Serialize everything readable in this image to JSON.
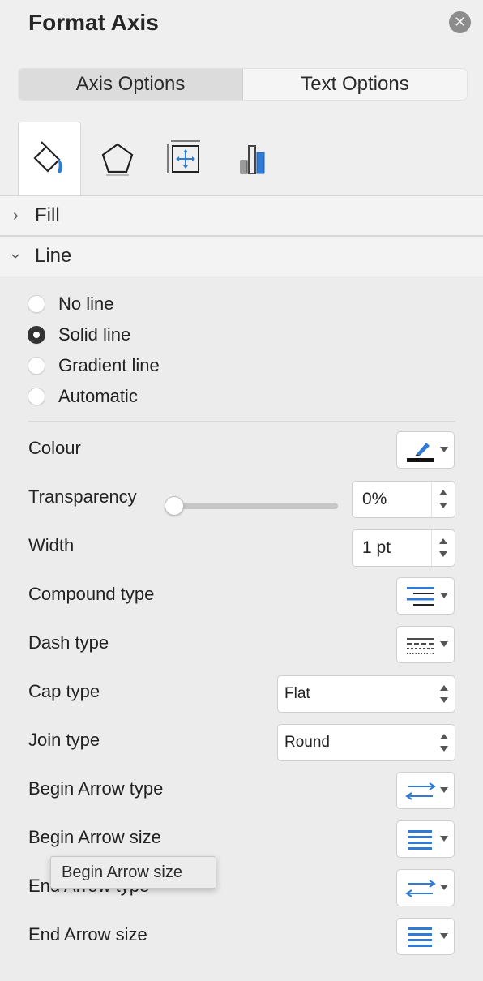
{
  "panel": {
    "title": "Format Axis",
    "close_icon": "close-icon"
  },
  "tabs": {
    "axis_options": "Axis Options",
    "text_options": "Text Options",
    "active": "Axis Options"
  },
  "icon_tabs": [
    {
      "name": "fill-and-line-tab",
      "icon": "paint-bucket-icon",
      "active": true
    },
    {
      "name": "effects-tab",
      "icon": "pentagon-icon",
      "active": false
    },
    {
      "name": "size-and-properties-tab",
      "icon": "size-properties-icon",
      "active": false
    },
    {
      "name": "axis-options-tab",
      "icon": "bar-chart-icon",
      "active": false
    }
  ],
  "sections": {
    "fill": {
      "label": "Fill",
      "expanded": false
    },
    "line": {
      "label": "Line",
      "expanded": true
    }
  },
  "line_options": {
    "radios": [
      {
        "label": "No line",
        "checked": false
      },
      {
        "label": "Solid line",
        "checked": true
      },
      {
        "label": "Gradient line",
        "checked": false
      },
      {
        "label": "Automatic",
        "checked": false
      }
    ]
  },
  "properties": {
    "colour": {
      "label": "Colour",
      "icon": "pen-colour-icon",
      "value_color": "#111111"
    },
    "transparency": {
      "label": "Transparency",
      "value": "0%",
      "slider_level": 0
    },
    "width": {
      "label": "Width",
      "value": "1 pt"
    },
    "compound_type": {
      "label": "Compound type",
      "icon": "compound-lines-icon"
    },
    "dash_type": {
      "label": "Dash type",
      "icon": "dash-lines-icon"
    },
    "cap_type": {
      "label": "Cap type",
      "value": "Flat"
    },
    "join_type": {
      "label": "Join type",
      "value": "Round"
    },
    "begin_arrow_type": {
      "label": "Begin Arrow type",
      "icon": "arrows-icon"
    },
    "begin_arrow_size": {
      "label": "Begin Arrow size",
      "icon": "size-lines-icon"
    },
    "end_arrow_type": {
      "label": "End Arrow type",
      "icon": "arrows-icon"
    },
    "end_arrow_size": {
      "label": "End Arrow size",
      "icon": "size-lines-icon"
    }
  },
  "tooltip": {
    "text": "Begin Arrow size"
  },
  "colors": {
    "accent_blue": "#2f7bd6",
    "panel_bg": "#f0efef"
  }
}
